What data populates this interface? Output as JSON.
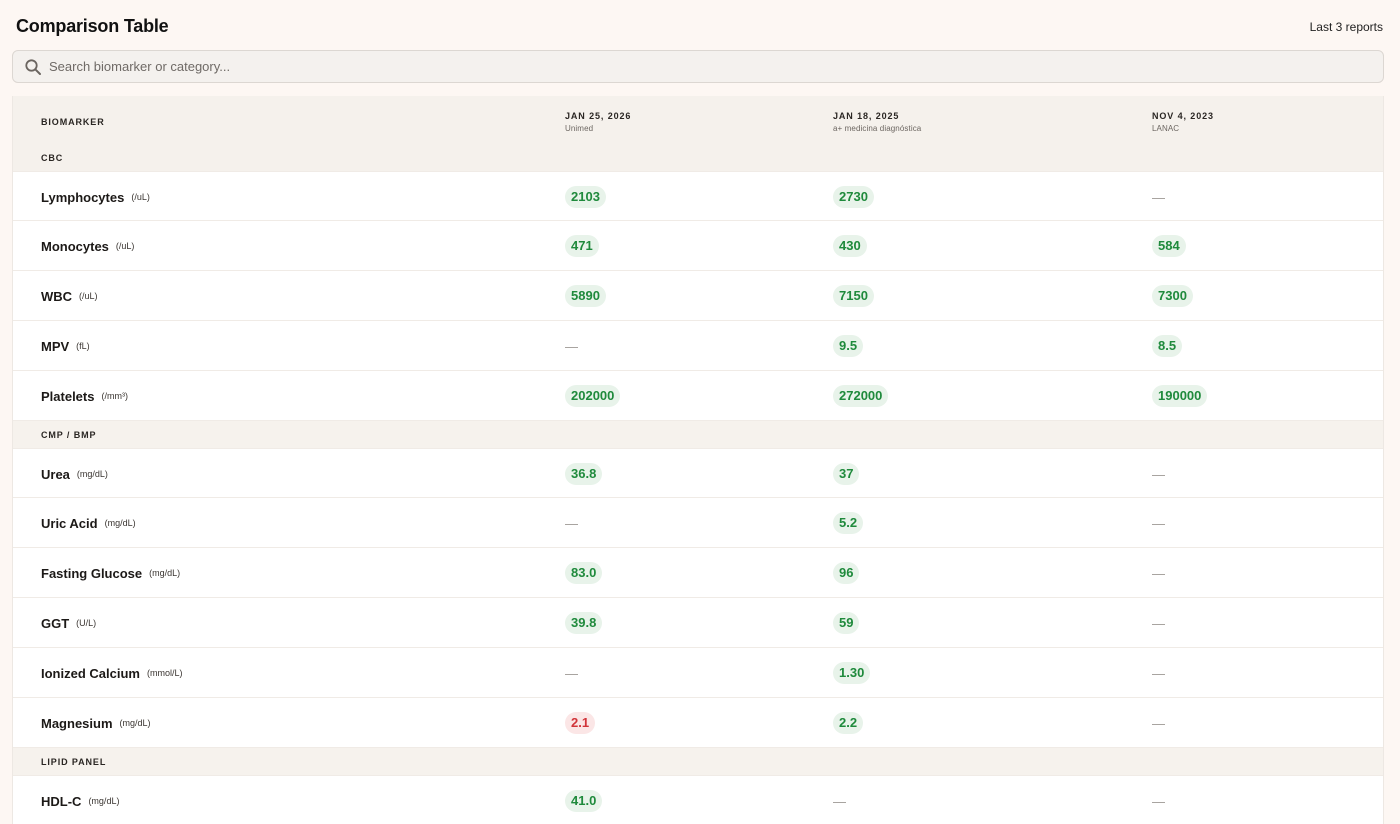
{
  "header": {
    "title": "Comparison Table",
    "reports_count": "Last 3 reports"
  },
  "search": {
    "placeholder": "Search biomarker or category...",
    "icon": "search-icon"
  },
  "table": {
    "biomarker_header": "BIOMARKER",
    "columns": [
      {
        "date": "JAN 25, 2026",
        "lab": "Unimed"
      },
      {
        "date": "JAN 18, 2025",
        "lab": "a+ medicina diagnóstica"
      },
      {
        "date": "NOV 4, 2023",
        "lab": "LANAC"
      }
    ],
    "sections": [
      {
        "name": "CBC",
        "rows": [
          {
            "name": "Lymphocytes",
            "unit": "(/uL)",
            "values": [
              {
                "v": "2103",
                "s": "ok"
              },
              {
                "v": "2730",
                "s": "ok"
              },
              {
                "v": "—",
                "s": "none"
              }
            ]
          },
          {
            "name": "Monocytes",
            "unit": "(/uL)",
            "values": [
              {
                "v": "471",
                "s": "ok"
              },
              {
                "v": "430",
                "s": "ok"
              },
              {
                "v": "584",
                "s": "ok"
              }
            ]
          },
          {
            "name": "WBC",
            "unit": "(/uL)",
            "values": [
              {
                "v": "5890",
                "s": "ok"
              },
              {
                "v": "7150",
                "s": "ok"
              },
              {
                "v": "7300",
                "s": "ok"
              }
            ]
          },
          {
            "name": "MPV",
            "unit": "(fL)",
            "values": [
              {
                "v": "—",
                "s": "none"
              },
              {
                "v": "9.5",
                "s": "ok"
              },
              {
                "v": "8.5",
                "s": "ok"
              }
            ]
          },
          {
            "name": "Platelets",
            "unit": "(/mm³)",
            "values": [
              {
                "v": "202000",
                "s": "ok"
              },
              {
                "v": "272000",
                "s": "ok"
              },
              {
                "v": "190000",
                "s": "ok"
              }
            ]
          }
        ]
      },
      {
        "name": "CMP / BMP",
        "rows": [
          {
            "name": "Urea",
            "unit": "(mg/dL)",
            "values": [
              {
                "v": "36.8",
                "s": "ok"
              },
              {
                "v": "37",
                "s": "ok"
              },
              {
                "v": "—",
                "s": "none"
              }
            ]
          },
          {
            "name": "Uric Acid",
            "unit": "(mg/dL)",
            "values": [
              {
                "v": "—",
                "s": "none"
              },
              {
                "v": "5.2",
                "s": "ok"
              },
              {
                "v": "—",
                "s": "none"
              }
            ]
          },
          {
            "name": "Fasting Glucose",
            "unit": "(mg/dL)",
            "values": [
              {
                "v": "83.0",
                "s": "ok"
              },
              {
                "v": "96",
                "s": "ok"
              },
              {
                "v": "—",
                "s": "none"
              }
            ]
          },
          {
            "name": "GGT",
            "unit": "(U/L)",
            "values": [
              {
                "v": "39.8",
                "s": "ok"
              },
              {
                "v": "59",
                "s": "ok"
              },
              {
                "v": "—",
                "s": "none"
              }
            ]
          },
          {
            "name": "Ionized Calcium",
            "unit": "(mmol/L)",
            "values": [
              {
                "v": "—",
                "s": "none"
              },
              {
                "v": "1.30",
                "s": "ok"
              },
              {
                "v": "—",
                "s": "none"
              }
            ]
          },
          {
            "name": "Magnesium",
            "unit": "(mg/dL)",
            "values": [
              {
                "v": "2.1",
                "s": "bad"
              },
              {
                "v": "2.2",
                "s": "ok"
              },
              {
                "v": "—",
                "s": "none"
              }
            ]
          }
        ]
      },
      {
        "name": "LIPID PANEL",
        "rows": [
          {
            "name": "HDL-C",
            "unit": "(mg/dL)",
            "values": [
              {
                "v": "41.0",
                "s": "ok"
              },
              {
                "v": "—",
                "s": "none"
              },
              {
                "v": "—",
                "s": "none"
              }
            ]
          }
        ]
      }
    ]
  },
  "colors": {
    "in_range_text": "#1f8a3c",
    "in_range_bg": "#e8f3ea",
    "out_of_range_text": "#d1343a",
    "out_of_range_bg": "#fbe6e6"
  }
}
